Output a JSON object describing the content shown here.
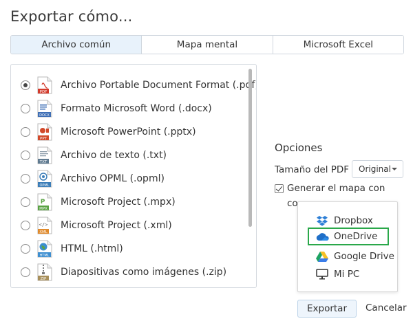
{
  "dialog": {
    "title": "Exportar cómo..."
  },
  "tabs": [
    {
      "label": "Archivo común",
      "active": true
    },
    {
      "label": "Mapa mental",
      "active": false
    },
    {
      "label": "Microsoft Excel",
      "active": false
    }
  ],
  "formats": [
    {
      "label": "Archivo Portable Document Format (.pdf)",
      "badge": "PDF",
      "color": "#d33b2c",
      "selected": true
    },
    {
      "label": "Formato Microsoft Word (.docx)",
      "badge": "DOCX",
      "color": "#3f6fb5",
      "selected": false
    },
    {
      "label": "Microsoft PowerPoint (.pptx)",
      "badge": "PPT",
      "color": "#d2492a",
      "selected": false
    },
    {
      "label": "Archivo de texto (.txt)",
      "badge": "TXT",
      "color": "#5f7a90",
      "selected": false
    },
    {
      "label": "Archivo OPML (.opml)",
      "badge": "OPML",
      "color": "#3b7db8",
      "selected": false
    },
    {
      "label": "Microsoft Project (.mpx)",
      "badge": "MPX",
      "color": "#5aa344",
      "selected": false
    },
    {
      "label": "Microsoft Project (.xml)",
      "badge": "XML",
      "color": "#e08a2c",
      "selected": false
    },
    {
      "label": "HTML (.html)",
      "badge": "HTML",
      "color": "#3d8ed0",
      "selected": false
    },
    {
      "label": "Diapositivas como imágenes (.zip)",
      "badge": "ZIP",
      "color": "#a88f5a",
      "selected": false
    }
  ],
  "options": {
    "title": "Opciones",
    "pdf_size_label": "Tamaño del PDF",
    "pdf_size_value": "Original",
    "generate_label_line1": "Generar el mapa con",
    "generate_label_line2": "co",
    "generate_checked": true
  },
  "destinations": [
    {
      "label": "Dropbox",
      "icon": "dropbox-icon",
      "highlighted": false
    },
    {
      "label": "OneDrive",
      "icon": "onedrive-icon",
      "highlighted": true
    },
    {
      "label": "Google Drive",
      "icon": "google-drive-icon",
      "highlighted": false
    },
    {
      "label": "Mi PC",
      "icon": "monitor-icon",
      "highlighted": false
    }
  ],
  "buttons": {
    "export": "Exportar",
    "cancel": "Cancelar"
  }
}
